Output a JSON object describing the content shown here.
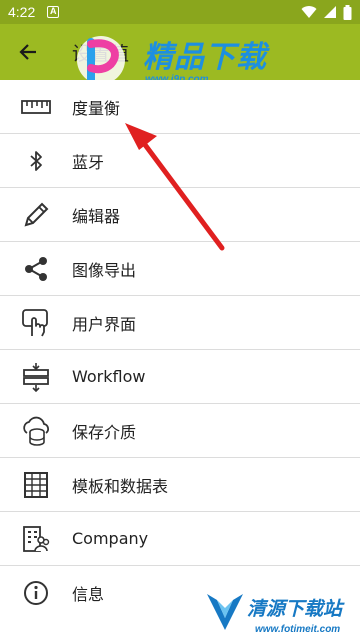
{
  "status_bar": {
    "time": "4:22",
    "notification_letter": "A",
    "icons": [
      "wifi-icon",
      "signal-icon",
      "battery-icon"
    ]
  },
  "app_bar": {
    "title": "设置值",
    "back_icon": "arrow-left-icon",
    "background_color": "#9cba22"
  },
  "settings": {
    "items": [
      {
        "label": "度量衡",
        "icon": "ruler-icon"
      },
      {
        "label": "蓝牙",
        "icon": "bluetooth-icon"
      },
      {
        "label": "编辑器",
        "icon": "pencil-icon"
      },
      {
        "label": "图像导出",
        "icon": "share-icon"
      },
      {
        "label": "用户界面",
        "icon": "touch-icon"
      },
      {
        "label": "Workflow",
        "icon": "workflow-icon"
      },
      {
        "label": "保存介质",
        "icon": "cloud-storage-icon"
      },
      {
        "label": "模板和数据表",
        "icon": "table-icon"
      },
      {
        "label": "Company",
        "icon": "company-icon"
      },
      {
        "label": "信息",
        "icon": "info-icon"
      }
    ]
  },
  "watermarks": {
    "top_text": "精品下载",
    "top_url": "www.j9p.com",
    "bottom_text": "清源下载站",
    "bottom_url": "www.fotimeit.com"
  },
  "annotation": {
    "arrow_color": "#e02020"
  }
}
